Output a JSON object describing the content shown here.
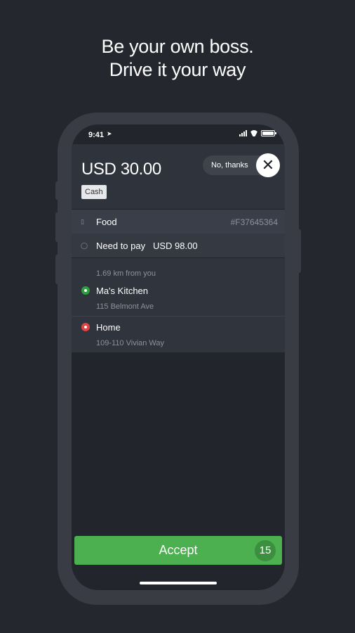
{
  "promo": {
    "line1": "Be your own boss.",
    "line2": "Drive it your way"
  },
  "status_bar": {
    "time": "9:41"
  },
  "order": {
    "amount": "USD 30.00",
    "payment_method": "Cash",
    "decline_label": "No, thanks",
    "category": "Food",
    "order_id": "#F37645364",
    "need_to_pay_label": "Need to pay",
    "need_to_pay_value": "USD 98.00"
  },
  "route": {
    "distance": "1.69 km from you",
    "pickup": {
      "name": "Ma's Kitchen",
      "address": "115 Belmont Ave",
      "color": "#2e9e3f"
    },
    "dropoff": {
      "name": "Home",
      "address": "109-110 Vivian Way",
      "color": "#e04343"
    }
  },
  "action": {
    "accept_label": "Accept",
    "timer": "15"
  },
  "colors": {
    "accent": "#4caf50",
    "background": "#24272e"
  },
  "icons": [
    "location-arrow-icon",
    "signal-icon",
    "wifi-icon",
    "battery-icon",
    "close-icon",
    "bag-icon",
    "info-icon"
  ]
}
